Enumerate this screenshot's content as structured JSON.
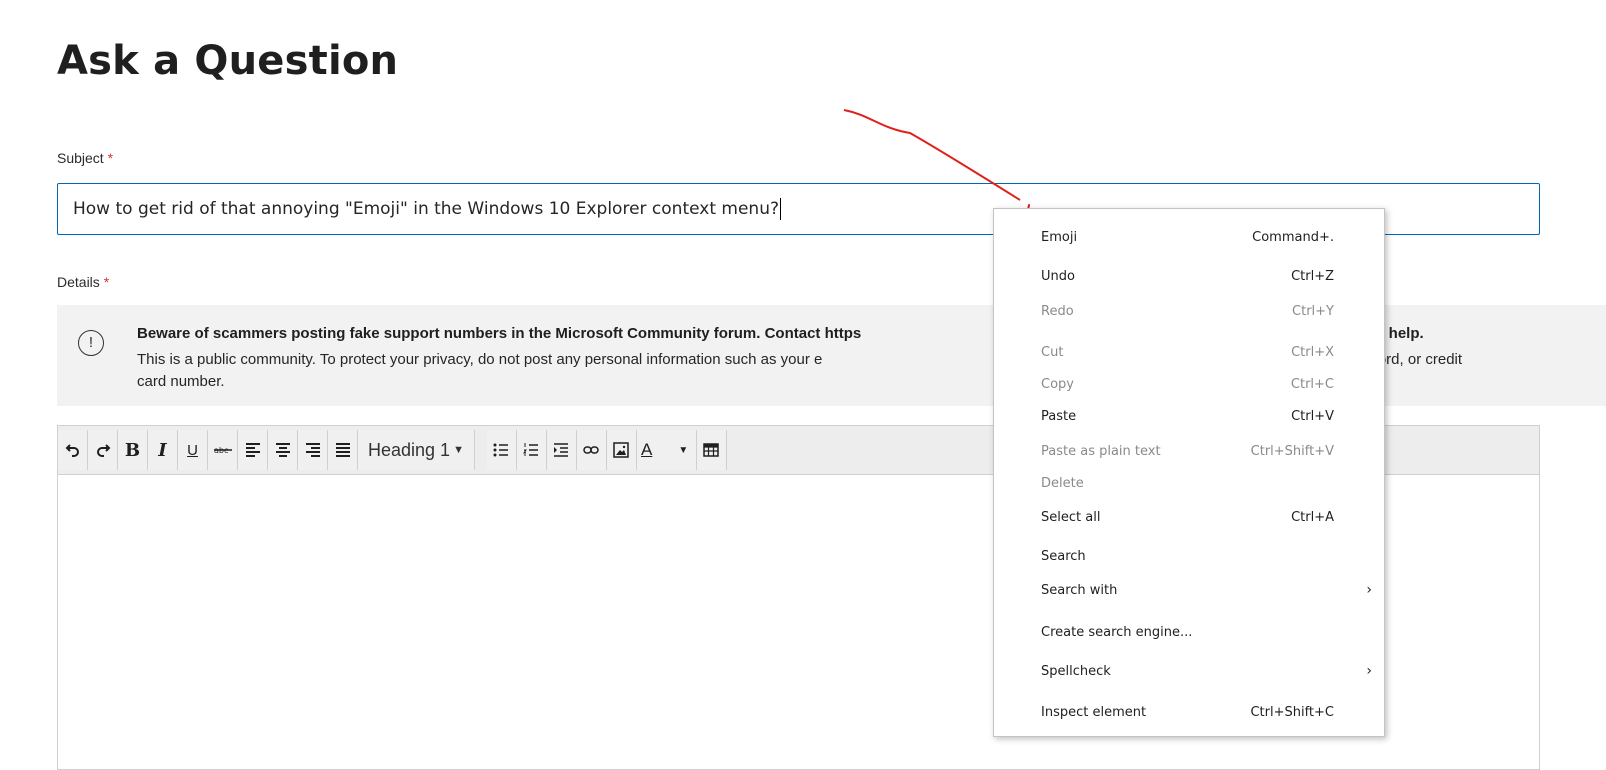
{
  "page": {
    "title": "Ask a Question"
  },
  "subject": {
    "label": "Subject",
    "required_mark": "*",
    "value": "How to get rid of that annoying \"Emoji\" in the Windows 10 Explorer context menu?"
  },
  "details": {
    "label": "Details",
    "required_mark": "*"
  },
  "warning": {
    "icon": "info-circle-icon",
    "title": "Beware of scammers posting fake support numbers in the Microsoft Community forum. Contact https",
    "title_end": "ed help.",
    "body": "This is a public community. To protect your privacy, do not post any personal information such as your e",
    "body_end": "word, or credit",
    "body_line2": "card number."
  },
  "toolbar": {
    "heading_label": "Heading 1",
    "buttons": [
      "undo-icon",
      "redo-icon",
      "bold",
      "italic",
      "underline",
      "strikethrough",
      "align-left",
      "align-center",
      "align-right",
      "justify",
      "bullet-list",
      "numbered-list",
      "indent",
      "link",
      "image",
      "font-color",
      "table"
    ],
    "bold_label": "B",
    "italic_label": "I",
    "underline_label": "U"
  },
  "context_menu": {
    "items": [
      {
        "label": "Emoji",
        "shortcut": "Command+.",
        "enabled": true
      },
      {
        "label": "Undo",
        "shortcut": "Ctrl+Z",
        "enabled": true
      },
      {
        "label": "Redo",
        "shortcut": "Ctrl+Y",
        "enabled": false
      },
      {
        "label": "Cut",
        "shortcut": "Ctrl+X",
        "enabled": false
      },
      {
        "label": "Copy",
        "shortcut": "Ctrl+C",
        "enabled": false
      },
      {
        "label": "Paste",
        "shortcut": "Ctrl+V",
        "enabled": true
      },
      {
        "label": "Paste as plain text",
        "shortcut": "Ctrl+Shift+V",
        "enabled": false
      },
      {
        "label": "Delete",
        "shortcut": "",
        "enabled": false
      },
      {
        "label": "Select all",
        "shortcut": "Ctrl+A",
        "enabled": true
      },
      {
        "label": "Search",
        "shortcut": "",
        "enabled": true
      },
      {
        "label": "Search with",
        "shortcut": "",
        "enabled": true,
        "submenu": true
      },
      {
        "label": "Create search engine...",
        "shortcut": "",
        "enabled": true
      },
      {
        "label": "Spellcheck",
        "shortcut": "",
        "enabled": true,
        "submenu": true
      },
      {
        "label": "Inspect element",
        "shortcut": "Ctrl+Shift+C",
        "enabled": true
      }
    ]
  },
  "colors": {
    "accent": "#0067b8",
    "required": "#d13438",
    "annotation": "#e0201b",
    "warning_bg": "#f2f2f2"
  }
}
